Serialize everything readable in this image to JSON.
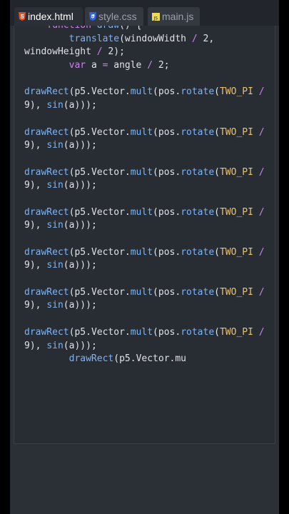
{
  "tabs": [
    {
      "label": "index.html",
      "icon": "html5-icon",
      "color": "#e44d26"
    },
    {
      "label": "style.css",
      "icon": "css3-icon",
      "color": "#2965f1"
    },
    {
      "label": "main.js",
      "icon": "js-icon",
      "color": "#f0db4f"
    }
  ],
  "code": {
    "lines": [
      "    function draw() {",
      "        translate(windowWidth / 2,",
      "windowHeight / 2);",
      "        var a = angle / 2;",
      "",
      "drawRect(p5.Vector.mult(pos.rotate(TWO_PI /",
      "9), sin(a)));",
      "",
      "drawRect(p5.Vector.mult(pos.rotate(TWO_PI /",
      "9), sin(a)));",
      "",
      "drawRect(p5.Vector.mult(pos.rotate(TWO_PI /",
      "9), sin(a)));",
      "",
      "drawRect(p5.Vector.mult(pos.rotate(TWO_PI /",
      "9), sin(a)));",
      "",
      "drawRect(p5.Vector.mult(pos.rotate(TWO_PI /",
      "9), sin(a)));",
      "",
      "drawRect(p5.Vector.mult(pos.rotate(TWO_PI /",
      "9), sin(a)));",
      "",
      "drawRect(p5.Vector.mult(pos.rotate(TWO_PI /",
      "9), sin(a)));",
      "        drawRect(p5.Vector.mu"
    ]
  },
  "colors": {
    "keyword": "#c983e9",
    "function": "#7db3f5",
    "constant": "#e8c26c",
    "text": "#dfe3e8"
  }
}
